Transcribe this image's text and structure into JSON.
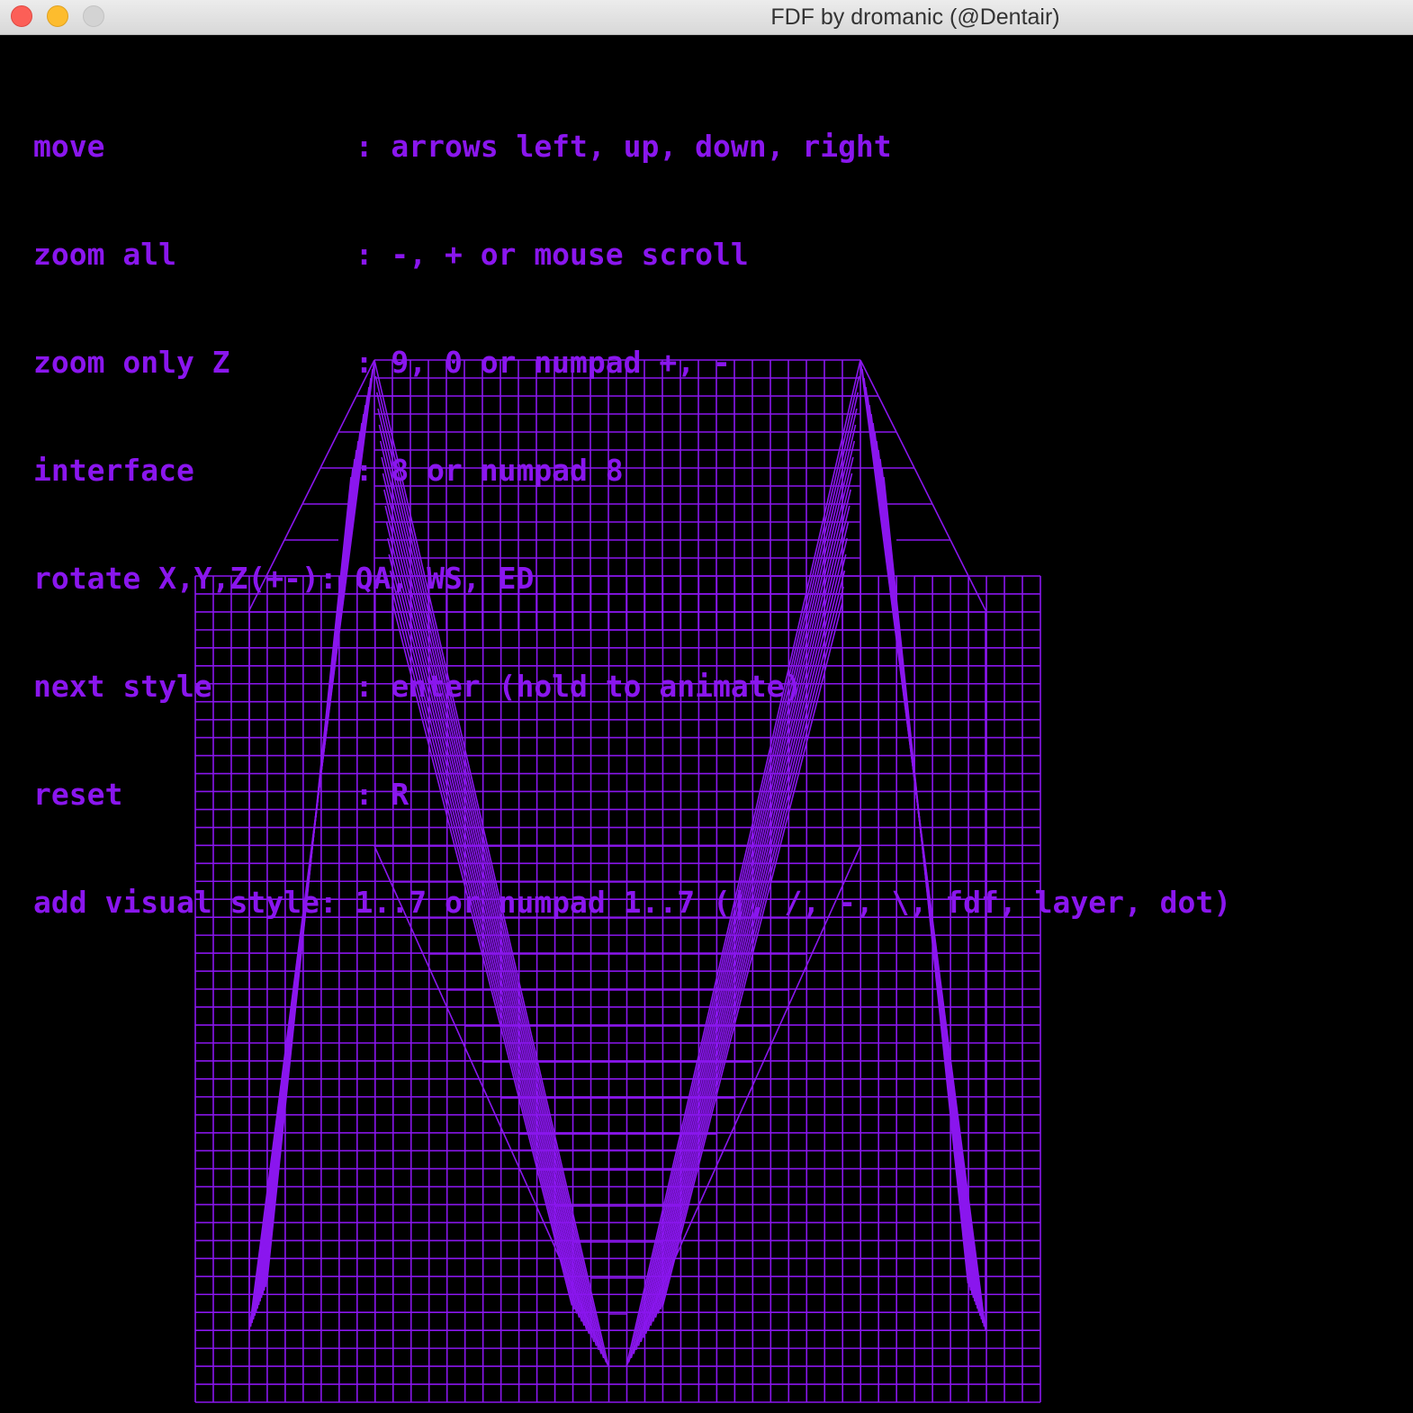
{
  "window": {
    "title": "FDF by dromanic (@Dentair)"
  },
  "colors": {
    "background": "#000000",
    "accent": "#8a16ee",
    "wire": "#8a16ee"
  },
  "help": [
    {
      "key": "move              ",
      "sep": ": ",
      "value": "arrows left, up, down, right"
    },
    {
      "key": "zoom all          ",
      "sep": ": ",
      "value": "-, + or mouse scroll"
    },
    {
      "key": "zoom only Z       ",
      "sep": ": ",
      "value": "9, 0 or numpad +, -"
    },
    {
      "key": "interface         ",
      "sep": ": ",
      "value": "8 or numpad 8"
    },
    {
      "key": "rotate X,Y,Z(+-)",
      "sep": ": ",
      "value": "QA, WS, ED"
    },
    {
      "key": "next style        ",
      "sep": ": ",
      "value": "enter (hold to animate)"
    },
    {
      "key": "reset             ",
      "sep": ": ",
      "value": "R"
    },
    {
      "key": "add visual style",
      "sep": ": ",
      "value": "1..7 or numpad 1..7 (|, /, -, \\, fdf, layer, dot)"
    }
  ],
  "render": {
    "style": "fdf",
    "shape": "M letter wireframe"
  }
}
